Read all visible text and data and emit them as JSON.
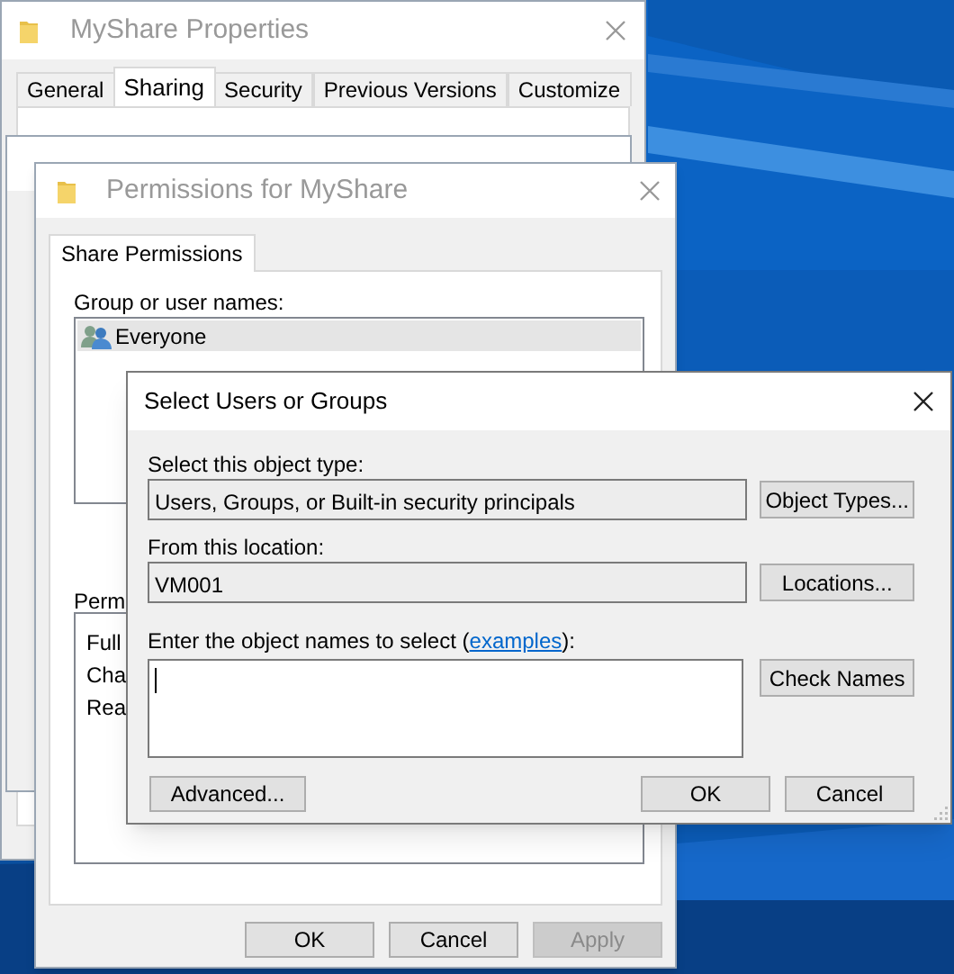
{
  "properties_window": {
    "title": "MyShare Properties",
    "tabs": [
      {
        "label": "General",
        "selected": false
      },
      {
        "label": "Sharing",
        "selected": true
      },
      {
        "label": "Security",
        "selected": false
      },
      {
        "label": "Previous Versions",
        "selected": false
      },
      {
        "label": "Customize",
        "selected": false
      }
    ]
  },
  "advanced_sharing_window": {
    "kind": "dialog"
  },
  "permissions_window": {
    "title": "Permissions for MyShare",
    "tabs": [
      {
        "label": "Share Permissions",
        "selected": true
      }
    ],
    "group_label": "Group or user names:",
    "users": [
      {
        "name": "Everyone",
        "selected": true
      }
    ],
    "permissions_label": "Perm",
    "permissions": [
      "Full",
      "Cha",
      "Rea"
    ],
    "buttons": [
      {
        "label": "OK",
        "disabled": false
      },
      {
        "label": "Cancel",
        "disabled": false
      },
      {
        "label": "Apply",
        "disabled": true
      }
    ]
  },
  "select_dialog": {
    "title": "Select Users or Groups",
    "object_type_label": "Select this object type:",
    "object_type_value": "Users, Groups, or Built-in security principals",
    "object_types_button": "Object Types...",
    "location_label": "From this location:",
    "location_value": "VM001",
    "locations_button": "Locations...",
    "names_label_before": "Enter the object names to select (",
    "names_link": "examples",
    "names_label_after": "):",
    "check_names_button": "Check Names",
    "advanced_button": "Advanced...",
    "ok_button": "OK",
    "cancel_button": "Cancel"
  }
}
